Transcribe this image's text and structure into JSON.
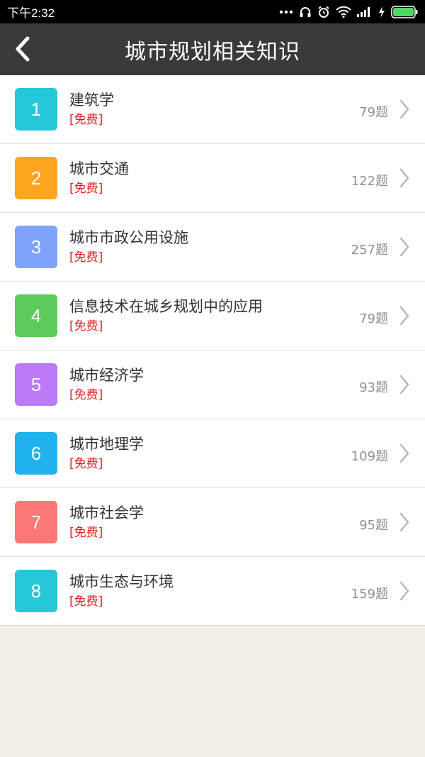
{
  "status": {
    "time": "下午2:32"
  },
  "header": {
    "title": "城市规划相关知识",
    "back_icon": "chevron-left-icon"
  },
  "colors": {
    "header_bg": "#383a3b",
    "free_tag": "#e02020"
  },
  "items": [
    {
      "num": "1",
      "name": "建筑学",
      "tag": "[免费]",
      "count": "79题",
      "color": "#26c7d9"
    },
    {
      "num": "2",
      "name": "城市交通",
      "tag": "[免费]",
      "count": "122题",
      "color": "#fca51d"
    },
    {
      "num": "3",
      "name": "城市市政公用设施",
      "tag": "[免费]",
      "count": "257题",
      "color": "#7fa2fb"
    },
    {
      "num": "4",
      "name": "信息技术在城乡规划中的应用",
      "tag": "[免费]",
      "count": "79题",
      "color": "#5ccb5a"
    },
    {
      "num": "5",
      "name": "城市经济学",
      "tag": "[免费]",
      "count": "93题",
      "color": "#bb7af6"
    },
    {
      "num": "6",
      "name": "城市地理学",
      "tag": "[免费]",
      "count": "109题",
      "color": "#1fb2ec"
    },
    {
      "num": "7",
      "name": "城市社会学",
      "tag": "[免费]",
      "count": "95题",
      "color": "#fb7876"
    },
    {
      "num": "8",
      "name": "城市生态与环境",
      "tag": "[免费]",
      "count": "159题",
      "color": "#26c7d9"
    }
  ]
}
